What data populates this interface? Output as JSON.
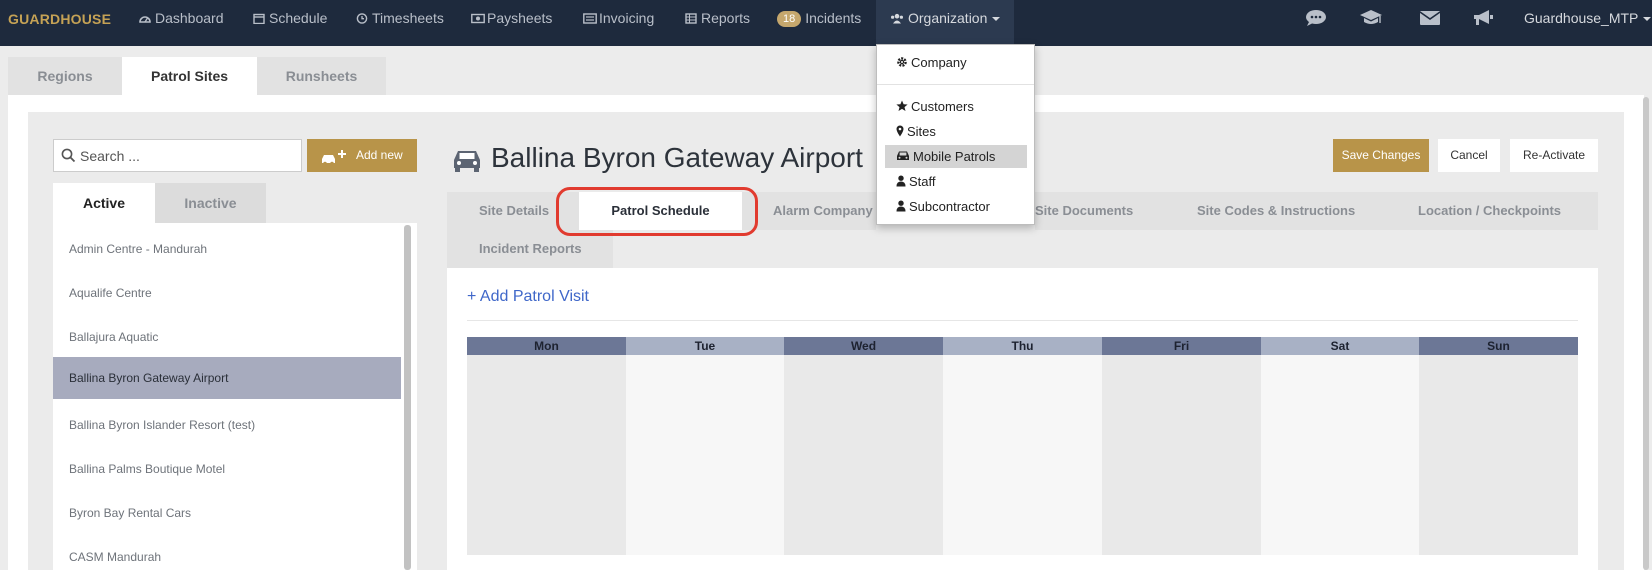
{
  "brand": "GUARDHOUSE",
  "nav": {
    "items": [
      {
        "label": "Dashboard",
        "icon": "dashboard-icon"
      },
      {
        "label": "Schedule",
        "icon": "calendar-icon"
      },
      {
        "label": "Timesheets",
        "icon": "clock-icon"
      },
      {
        "label": "Paysheets",
        "icon": "money-icon"
      },
      {
        "label": "Invoicing",
        "icon": "invoice-icon"
      },
      {
        "label": "Reports",
        "icon": "table-icon"
      }
    ],
    "incidents": {
      "badge": "18",
      "label": "Incidents"
    },
    "organization": {
      "label": "Organization",
      "icon": "users-icon"
    },
    "right_icons": [
      "chat-icon",
      "graduation-cap-icon",
      "envelope-icon",
      "bullhorn-icon"
    ],
    "user": "Guardhouse_MTP"
  },
  "main_tabs": [
    "Regions",
    "Patrol Sites",
    "Runsheets"
  ],
  "search": {
    "placeholder": "Search ..."
  },
  "add_new": "Add new",
  "list_tabs": {
    "active": "Active",
    "inactive": "Inactive"
  },
  "sites": [
    "Admin Centre - Mandurah",
    "Aqualife Centre",
    "Ballajura Aquatic",
    "Ballina Byron Gateway Airport",
    "Ballina Byron Islander Resort (test)",
    "Ballina Palms Boutique Motel",
    "Byron Bay Rental Cars",
    "CASM Mandurah"
  ],
  "selected_site": "Ballina Byron Gateway Airport",
  "title": "Ballina Byron Gateway Airport",
  "buttons": {
    "save": "Save Changes",
    "cancel": "Cancel",
    "reactivate": "Re-Activate"
  },
  "detail_tabs": {
    "site_details": "Site Details",
    "patrol_schedule": "Patrol Schedule",
    "alarm_company": "Alarm Company",
    "site_documents": "Site Documents",
    "site_codes": "Site Codes & Instructions",
    "location": "Location / Checkpoints",
    "incident_reports": "Incident Reports"
  },
  "add_patrol_visit": "+ Add Patrol Visit",
  "days": [
    "Mon",
    "Tue",
    "Wed",
    "Thu",
    "Fri",
    "Sat",
    "Sun"
  ],
  "org_menu": {
    "company": "Company",
    "customers": "Customers",
    "sites": "Sites",
    "mobile_patrols": "Mobile Patrols",
    "staff": "Staff",
    "subcontractor": "Subcontractor"
  },
  "colors": {
    "nav_bg": "#1e2a3d",
    "brand": "#c5a255",
    "accent_gold": "#b89449",
    "link_blue": "#3f67c9",
    "highlight_red": "#e13b2f",
    "selected_row": "#a7abbe"
  }
}
